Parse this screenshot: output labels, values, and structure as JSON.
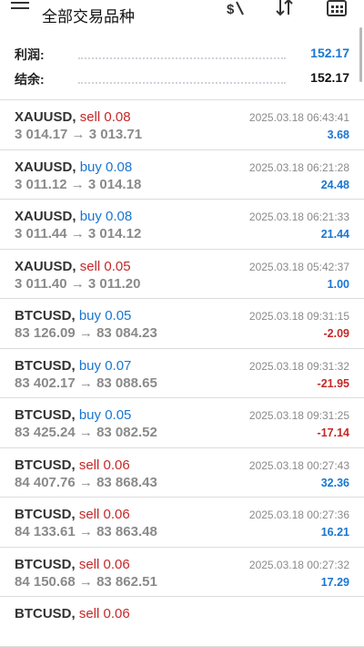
{
  "header": {
    "title": "全部交易品种",
    "icons": [
      "menu-icon",
      "dollar-sort-icon",
      "sort-icon",
      "calendar-icon"
    ]
  },
  "summary": {
    "profit_label": "利润:",
    "profit_value": "152.17",
    "balance_label": "结余:",
    "balance_value": "152.17",
    "profit_color": "#1976d2"
  },
  "colors": {
    "sell": "#c62828",
    "buy": "#1976d2",
    "positive": "#1976d2",
    "negative": "#c62828"
  },
  "trades": [
    {
      "symbol": "XAUUSD,",
      "dir": "sell 0.08",
      "type": "sell",
      "prices": "3 014.17 → 3 013.71",
      "time": "2025.03.18 06:43:41",
      "profit": "3.68",
      "sign": "pos"
    },
    {
      "symbol": "XAUUSD,",
      "dir": "buy 0.08",
      "type": "buy",
      "prices": "3 011.12 → 3 014.18",
      "time": "2025.03.18 06:21:28",
      "profit": "24.48",
      "sign": "pos"
    },
    {
      "symbol": "XAUUSD,",
      "dir": "buy 0.08",
      "type": "buy",
      "prices": "3 011.44 → 3 014.12",
      "time": "2025.03.18 06:21:33",
      "profit": "21.44",
      "sign": "pos"
    },
    {
      "symbol": "XAUUSD,",
      "dir": "sell 0.05",
      "type": "sell",
      "prices": "3 011.40 → 3 011.20",
      "time": "2025.03.18 05:42:37",
      "profit": "1.00",
      "sign": "pos"
    },
    {
      "symbol": "BTCUSD,",
      "dir": "buy 0.05",
      "type": "buy",
      "prices": "83 126.09 → 83 084.23",
      "time": "2025.03.18 09:31:15",
      "profit": "-2.09",
      "sign": "neg"
    },
    {
      "symbol": "BTCUSD,",
      "dir": "buy 0.07",
      "type": "buy",
      "prices": "83 402.17 → 83 088.65",
      "time": "2025.03.18 09:31:32",
      "profit": "-21.95",
      "sign": "neg"
    },
    {
      "symbol": "BTCUSD,",
      "dir": "buy 0.05",
      "type": "buy",
      "prices": "83 425.24 → 83 082.52",
      "time": "2025.03.18 09:31:25",
      "profit": "-17.14",
      "sign": "neg"
    },
    {
      "symbol": "BTCUSD,",
      "dir": "sell 0.06",
      "type": "sell",
      "prices": "84 407.76 → 83 868.43",
      "time": "2025.03.18 00:27:43",
      "profit": "32.36",
      "sign": "pos"
    },
    {
      "symbol": "BTCUSD,",
      "dir": "sell 0.06",
      "type": "sell",
      "prices": "84 133.61 → 83 863.48",
      "time": "2025.03.18 00:27:36",
      "profit": "16.21",
      "sign": "pos"
    },
    {
      "symbol": "BTCUSD,",
      "dir": "sell 0.06",
      "type": "sell",
      "prices": "84 150.68 → 83 862.51",
      "time": "2025.03.18 00:27:32",
      "profit": "17.29",
      "sign": "pos"
    },
    {
      "symbol": "BTCUSD,",
      "dir": "sell 0.06",
      "type": "sell",
      "prices": "",
      "time": "",
      "profit": "",
      "sign": "pos"
    }
  ]
}
